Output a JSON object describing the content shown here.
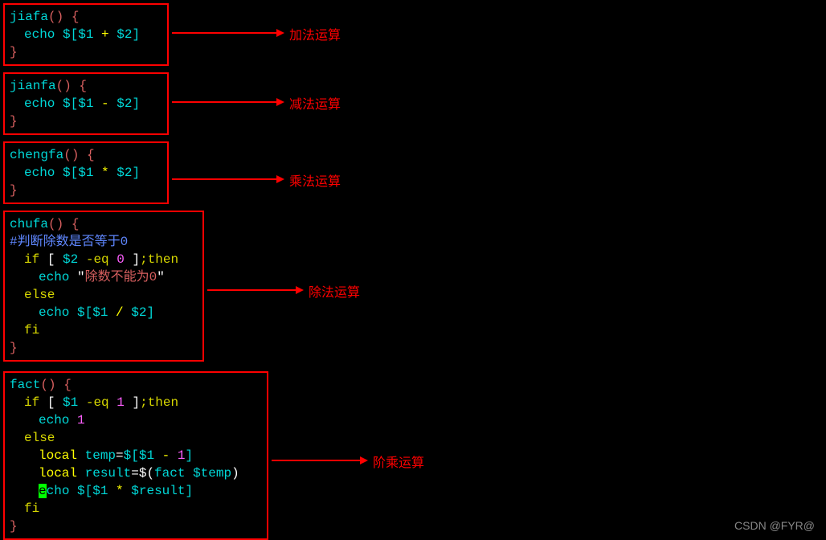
{
  "blocks": {
    "jiafa": {
      "funcname": "jiafa",
      "echo": "echo",
      "expr_open": "$[",
      "v1": "$1",
      "op": "+",
      "v2": "$2",
      "expr_close": "]",
      "label": "加法运算"
    },
    "jianfa": {
      "funcname": "jianfa",
      "echo": "echo",
      "expr_open": "$[",
      "v1": "$1",
      "op": "-",
      "v2": "$2",
      "expr_close": "]",
      "label": "减法运算"
    },
    "chengfa": {
      "funcname": "chengfa",
      "echo": "echo",
      "expr_open": "$[",
      "v1": "$1",
      "op": "*",
      "v2": "$2",
      "expr_close": "]",
      "label": "乘法运算"
    },
    "chufa": {
      "funcname": "chufa",
      "comment": "#判断除数是否等于0",
      "if": "if",
      "lbracket": "[",
      "testvar": "$2",
      "testop": "-eq",
      "zero": "0",
      "rbracket": "]",
      "semi_then": ";then",
      "echo1": "echo",
      "errstr": "除数不能为0",
      "else": "else",
      "echo2": "echo",
      "expr_open": "$[",
      "v1": "$1",
      "op": "/",
      "v2": "$2",
      "expr_close": "]",
      "fi": "fi",
      "label": "除法运算"
    },
    "fact": {
      "funcname": "fact",
      "if": "if",
      "lbracket": "[",
      "testvar": "$1",
      "testop": "-eq",
      "one": "1",
      "rbracket": "]",
      "semi_then": ";then",
      "echo1": "echo",
      "ret1": "1",
      "else": "else",
      "local1": "local",
      "tempvar": "temp",
      "eq": "=",
      "expr_open": "$[",
      "v1": "$1",
      "minus": "-",
      "n1": "1",
      "expr_close": "]",
      "local2": "local",
      "resultvar": "result",
      "subopen": "$(",
      "call": "fact",
      "callarg": "$temp",
      "subclose": ")",
      "cursor_e": "e",
      "cho": "cho",
      "expr2_open": "$[",
      "v1b": "$1",
      "times": "*",
      "resultref": "$result",
      "expr2_close": "]",
      "fi": "fi",
      "label": "阶乘运算"
    }
  },
  "watermark": "CSDN @FYR@"
}
